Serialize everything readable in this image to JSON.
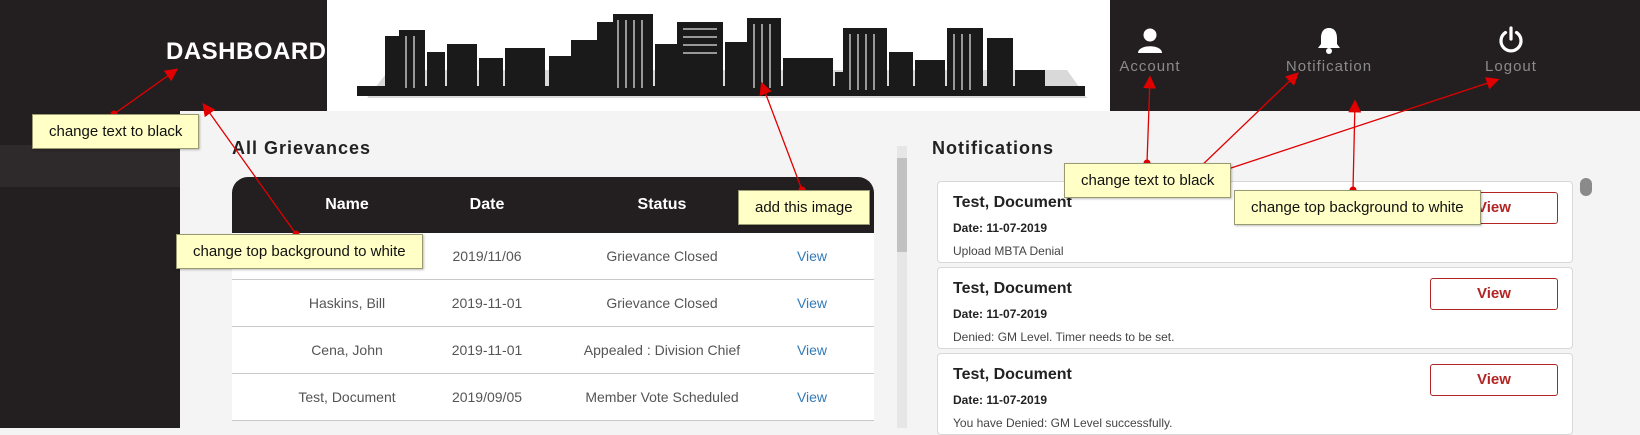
{
  "header": {
    "title": "DASHBOARD",
    "nav": [
      {
        "label": "Account",
        "icon": "user-icon"
      },
      {
        "label": "Notification",
        "icon": "bell-icon"
      },
      {
        "label": "Logout",
        "icon": "power-icon"
      }
    ]
  },
  "grievances": {
    "title": "All Grievances",
    "columns": [
      "Name",
      "Date",
      "Status",
      ""
    ],
    "rows": [
      {
        "name": "",
        "date": "2019/11/06",
        "status": "Grievance Closed",
        "action": "View"
      },
      {
        "name": "Haskins, Bill",
        "date": "2019-11-01",
        "status": "Grievance Closed",
        "action": "View"
      },
      {
        "name": "Cena, John",
        "date": "2019-11-01",
        "status": "Appealed : Division Chief",
        "action": "View"
      },
      {
        "name": "Test, Document",
        "date": "2019/09/05",
        "status": "Member Vote Scheduled",
        "action": "View"
      }
    ]
  },
  "notifications": {
    "title": "Notifications",
    "items": [
      {
        "title": "Test, Document",
        "date_label": "Date:",
        "date": "11-07-2019",
        "message": "Upload MBTA Denial",
        "button": "View"
      },
      {
        "title": "Test, Document",
        "date_label": "Date:",
        "date": "11-07-2019",
        "message": "Denied: GM Level. Timer needs to be set.",
        "button": "View"
      },
      {
        "title": "Test, Document",
        "date_label": "Date:",
        "date": "11-07-2019",
        "message": "You have Denied: GM Level successfully.",
        "button": "View"
      }
    ]
  },
  "annotations": [
    {
      "text": "change text to black"
    },
    {
      "text": "change top background to white"
    },
    {
      "text": "add this image"
    },
    {
      "text": "change text to black"
    },
    {
      "text": "change top background to white"
    }
  ],
  "colors": {
    "dark": "#231f20",
    "link": "#337ab7",
    "button_red": "#b32525",
    "note_bg": "#ffffc6",
    "arrow_red": "#e00000"
  }
}
